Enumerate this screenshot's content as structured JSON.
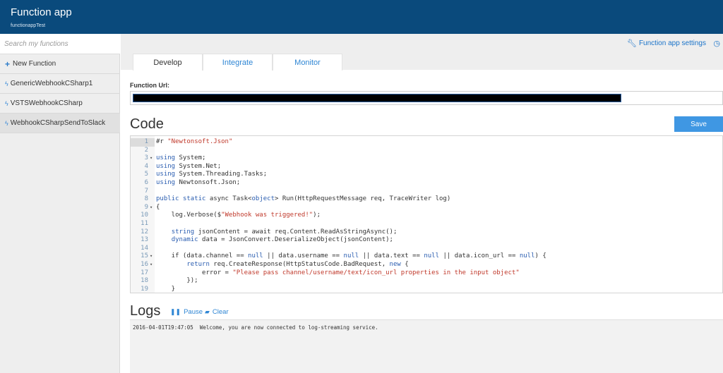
{
  "header": {
    "title": "Function app",
    "subtitle": "functionappTest"
  },
  "sidebar": {
    "search_placeholder": "Search my functions",
    "new_function_label": "New Function",
    "functions": [
      "GenericWebhookCSharp1",
      "VSTSWebhookCSharp",
      "WebhookCSharpSendToSlack"
    ],
    "selected_index": 2
  },
  "toolbar": {
    "settings_label": "Function app settings"
  },
  "tabs": [
    {
      "label": "Develop",
      "active": true
    },
    {
      "label": "Integrate",
      "active": false
    },
    {
      "label": "Monitor",
      "active": false
    }
  ],
  "function_url": {
    "label": "Function Url:"
  },
  "code": {
    "heading": "Code",
    "save_label": "Save",
    "active_line": 1,
    "lines": [
      {
        "n": "1",
        "fold": "",
        "text": "#r \"Newtonsoft.Json\""
      },
      {
        "n": "2",
        "fold": "",
        "text": ""
      },
      {
        "n": "3",
        "fold": "▾",
        "text": "using System;"
      },
      {
        "n": "4",
        "fold": "",
        "text": "using System.Net;"
      },
      {
        "n": "5",
        "fold": "",
        "text": "using System.Threading.Tasks;"
      },
      {
        "n": "6",
        "fold": "",
        "text": "using Newtonsoft.Json;"
      },
      {
        "n": "7",
        "fold": "",
        "text": ""
      },
      {
        "n": "8",
        "fold": "",
        "text": "public static async Task<object> Run(HttpRequestMessage req, TraceWriter log)"
      },
      {
        "n": "9",
        "fold": "▾",
        "text": "{"
      },
      {
        "n": "10",
        "fold": "",
        "text": "    log.Verbose($\"Webhook was triggered!\");"
      },
      {
        "n": "11",
        "fold": "",
        "text": ""
      },
      {
        "n": "12",
        "fold": "",
        "text": "    string jsonContent = await req.Content.ReadAsStringAsync();"
      },
      {
        "n": "13",
        "fold": "",
        "text": "    dynamic data = JsonConvert.DeserializeObject(jsonContent);"
      },
      {
        "n": "14",
        "fold": "",
        "text": ""
      },
      {
        "n": "15",
        "fold": "▾",
        "text": "    if (data.channel == null || data.username == null || data.text == null || data.icon_url == null) {"
      },
      {
        "n": "16",
        "fold": "▾",
        "text": "        return req.CreateResponse(HttpStatusCode.BadRequest, new {"
      },
      {
        "n": "17",
        "fold": "",
        "text": "            error = \"Please pass channel/username/text/icon_url properties in the input object\""
      },
      {
        "n": "18",
        "fold": "",
        "text": "        });"
      },
      {
        "n": "19",
        "fold": "",
        "text": "    }"
      }
    ]
  },
  "logs": {
    "heading": "Logs",
    "pause_label": "Pause",
    "clear_label": "Clear",
    "entries": [
      "2016-04-01T19:47:05  Welcome, you are now connected to log-streaming service."
    ]
  },
  "colors": {
    "header_bg": "#0a4a7c",
    "accent": "#2f86d4",
    "save_bg": "#3f97e3",
    "keyword": "#2a5db0",
    "string": "#c0392b"
  },
  "icons": [
    "plus-icon",
    "bolt-icon",
    "wrench-icon",
    "clock-icon",
    "pause-icon",
    "clear-icon"
  ]
}
